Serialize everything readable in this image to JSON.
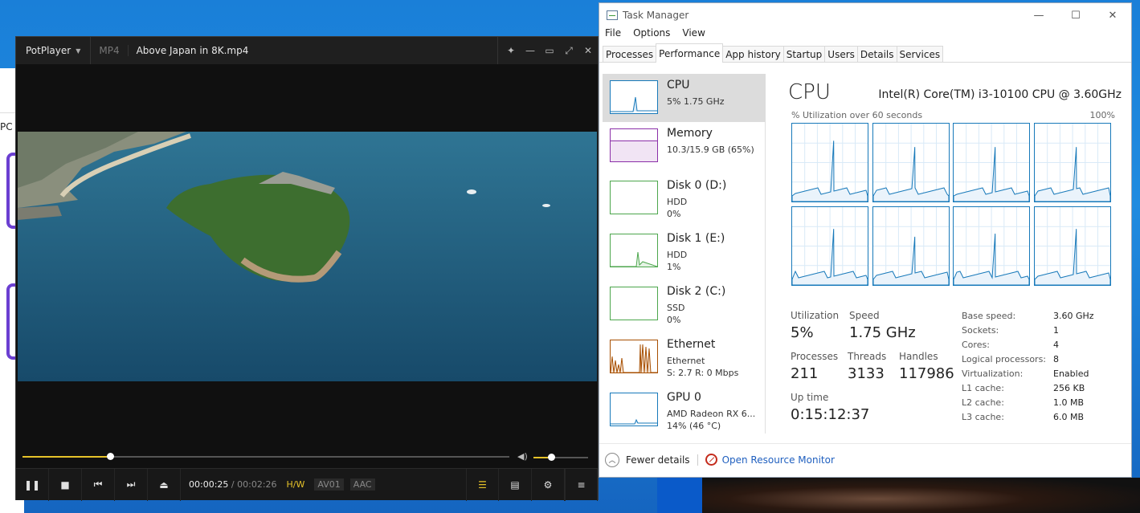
{
  "potplayer": {
    "brand": "PotPlayer",
    "format": "MP4",
    "title": "Above Japan in 8K.mp4",
    "time_current": "00:00:25",
    "time_separator": "/",
    "time_total": "00:02:26",
    "tags": {
      "hw": "H/W",
      "video_codec": "AV01",
      "audio_codec": "AAC"
    },
    "seek_progress": 0.18,
    "volume": 0.32,
    "accent": "#e6c229"
  },
  "taskmgr": {
    "title": "Task Manager",
    "menu": [
      "File",
      "Options",
      "View"
    ],
    "tabs": [
      "Processes",
      "Performance",
      "App history",
      "Startup",
      "Users",
      "Details",
      "Services"
    ],
    "active_tab": "Performance",
    "resources": [
      {
        "name": "CPU",
        "lines": [
          "5%  1.75 GHz"
        ],
        "color": "#1779ba"
      },
      {
        "name": "Memory",
        "lines": [
          "10.3/15.9 GB (65%)"
        ],
        "color": "#8b2fa8"
      },
      {
        "name": "Disk 0 (D:)",
        "lines": [
          "HDD",
          "0%"
        ],
        "color": "#4ca64c"
      },
      {
        "name": "Disk 1 (E:)",
        "lines": [
          "HDD",
          "1%"
        ],
        "color": "#4ca64c"
      },
      {
        "name": "Disk 2 (C:)",
        "lines": [
          "SSD",
          "0%"
        ],
        "color": "#4ca64c"
      },
      {
        "name": "Ethernet",
        "lines": [
          "Ethernet",
          "S: 2.7 R: 0 Mbps"
        ],
        "color": "#a74f01"
      },
      {
        "name": "GPU 0",
        "lines": [
          "AMD Radeon RX 6...",
          "14%  (46 °C)"
        ],
        "color": "#1779ba"
      }
    ],
    "cpu": {
      "title": "CPU",
      "model": "Intel(R) Core(TM) i3-10100 CPU @ 3.60GHz",
      "util_label": "% Utilization over 60 seconds",
      "util_max": "100%",
      "stats": [
        {
          "label": "Utilization",
          "value": "5%"
        },
        {
          "label": "Speed",
          "value": "1.75 GHz"
        },
        {
          "label": "Processes",
          "value": "211"
        },
        {
          "label": "Threads",
          "value": "3133"
        },
        {
          "label": "Handles",
          "value": "117986"
        },
        {
          "label": "Up time",
          "value": "0:15:12:37"
        }
      ],
      "specs": [
        {
          "label": "Base speed:",
          "value": "3.60 GHz"
        },
        {
          "label": "Sockets:",
          "value": "1"
        },
        {
          "label": "Cores:",
          "value": "4"
        },
        {
          "label": "Logical processors:",
          "value": "8"
        },
        {
          "label": "Virtualization:",
          "value": "Enabled"
        },
        {
          "label": "L1 cache:",
          "value": "256 KB"
        },
        {
          "label": "L2 cache:",
          "value": "1.0 MB"
        },
        {
          "label": "L3 cache:",
          "value": "6.0 MB"
        }
      ]
    },
    "footer": {
      "fewer_details": "Fewer details",
      "open_resmon": "Open Resource Monitor"
    }
  },
  "background": {
    "left_window_text": "PC"
  }
}
